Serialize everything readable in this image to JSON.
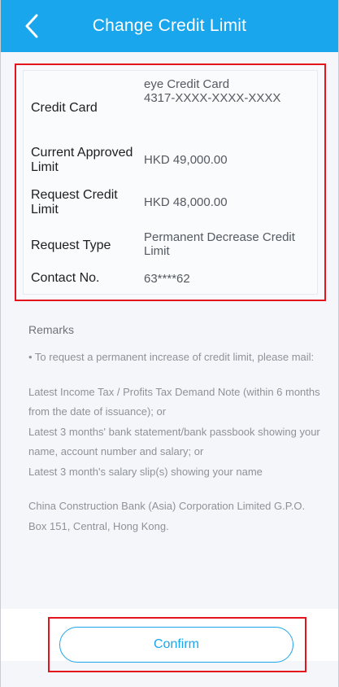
{
  "header": {
    "title": "Change Credit Limit",
    "back_icon": "chevron-left-icon"
  },
  "details": [
    {
      "label": "Credit Card",
      "value": "eye Credit Card\n4317-XXXX-XXXX-XXXX"
    },
    {
      "label": "Current Approved Limit",
      "value": "HKD 49,000.00"
    },
    {
      "label": "Request Credit Limit",
      "value": "HKD 48,000.00"
    },
    {
      "label": "Request Type",
      "value": "Permanent Decrease Credit Limit"
    },
    {
      "label": "Contact No.",
      "value": "63****62"
    }
  ],
  "remarks": {
    "title": "Remarks",
    "intro": "• To request a permanent increase of credit limit, please mail:",
    "items": [
      "Latest Income Tax / Profits Tax Demand Note (within 6 months from the date of issuance); or",
      "Latest 3 months' bank statement/bank passbook showing your name, account number and salary; or",
      "Latest 3 month's salary slip(s) showing your name"
    ],
    "address": "China Construction Bank (Asia) Corporation Limited G.P.O. Box 151, Central, Hong Kong."
  },
  "confirm_label": "Confirm",
  "colors": {
    "header": "#1aa6ec",
    "accent": "#1aa6ec",
    "highlight": "#e3141c"
  }
}
